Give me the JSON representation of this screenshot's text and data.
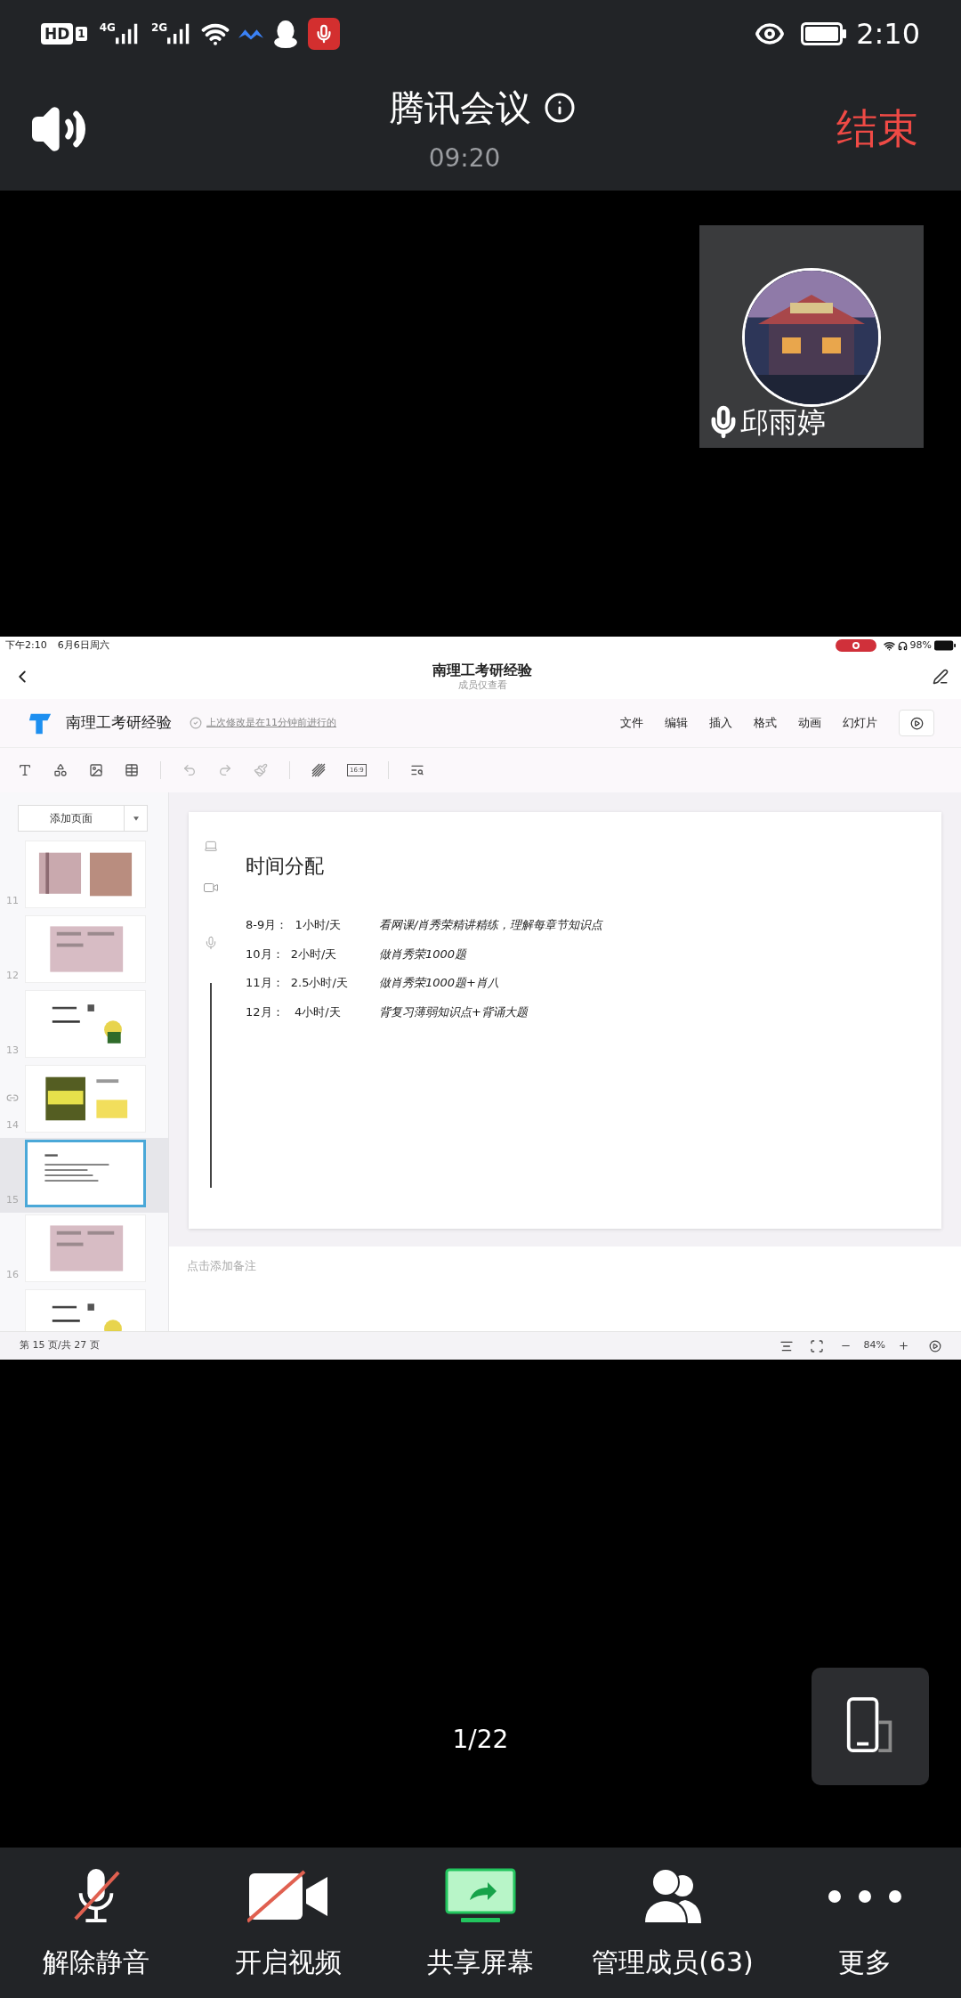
{
  "status_bar": {
    "hd": "HD",
    "sim": "1",
    "net1": "4G",
    "net2": "2G",
    "time": "2:10"
  },
  "header": {
    "title": "腾讯会议",
    "timer": "09:20",
    "end_button": "结束"
  },
  "participant": {
    "name": "邱雨婷"
  },
  "shared_screen": {
    "ipad_status": {
      "time": "下午2:10",
      "date": "6月6日周六",
      "battery": "98%",
      "recording": true
    },
    "nav": {
      "title": "南理工考研经验",
      "subtitle": "成员仅查看"
    },
    "doc": {
      "name": "南理工考研经验",
      "saved": "上次修改是在11分钟前进行的",
      "menu": [
        "文件",
        "编辑",
        "插入",
        "格式",
        "动画",
        "幻灯片"
      ]
    },
    "toolbar": {
      "aspect": "16:9"
    },
    "sidebar": {
      "add_page": "添加页面",
      "thumbnails": [
        {
          "number": "11",
          "selected": false,
          "comment": false
        },
        {
          "number": "12",
          "selected": false,
          "comment": false
        },
        {
          "number": "13",
          "selected": false,
          "comment": false
        },
        {
          "number": "14",
          "selected": false,
          "comment": true
        },
        {
          "number": "15",
          "selected": true,
          "comment": false
        },
        {
          "number": "16",
          "selected": false,
          "comment": false
        },
        {
          "selected": false
        }
      ]
    },
    "slide": {
      "title": "时间分配",
      "rows": [
        {
          "period": "8-9月：  1小时/天",
          "task": "看网课/肖秀荣精讲精练，理解每章节知识点"
        },
        {
          "period": "10月：  2小时/天",
          "task": "做肖秀荣1000题"
        },
        {
          "period": "11月：  2.5小时/天",
          "task": "做肖秀荣1000题+肖八"
        },
        {
          "period": "12月：   4小时/天",
          "task": "背复习薄弱知识点+背诵大题"
        }
      ]
    },
    "notes": {
      "placeholder": "点击添加备注"
    },
    "footer": {
      "page": "第 15 页/共 27 页",
      "zoom": "84%"
    }
  },
  "page_indicator": "1/22",
  "controls": [
    {
      "kind": "mic",
      "label": "解除静音",
      "crossed": true
    },
    {
      "kind": "video",
      "label": "开启视频",
      "crossed": true
    },
    {
      "kind": "share",
      "label": "共享屏幕"
    },
    {
      "kind": "members",
      "label": "管理成员(63)"
    },
    {
      "kind": "more",
      "label": "更多"
    }
  ]
}
